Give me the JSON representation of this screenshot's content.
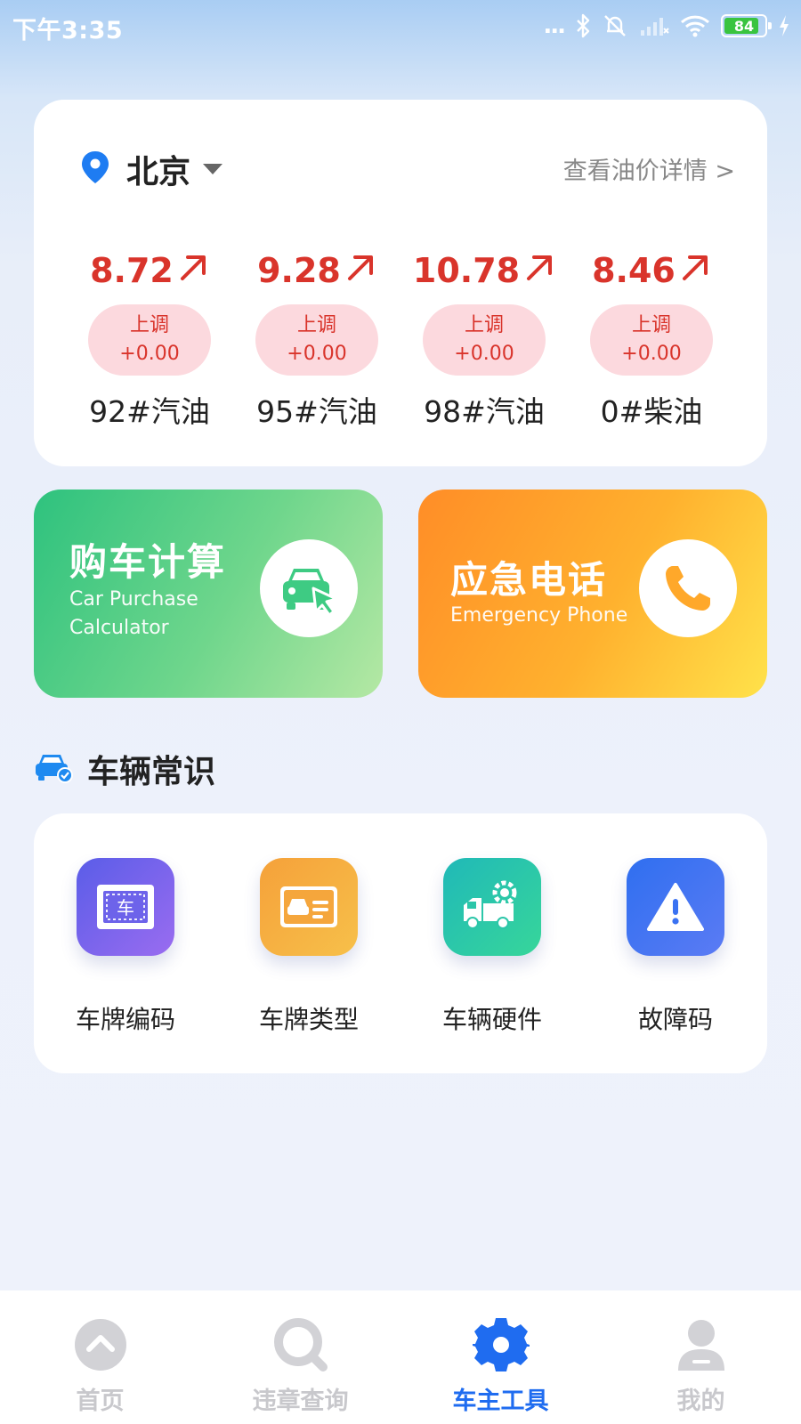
{
  "status_bar": {
    "time": "下午3:35",
    "dots": "...",
    "battery_level": "84"
  },
  "oil_card": {
    "city": "北京",
    "detail_link": "查看油价详情 >",
    "prices": [
      {
        "price": "8.72",
        "change_label": "上调",
        "change_value": "+0.00",
        "fuel": "92#汽油"
      },
      {
        "price": "9.28",
        "change_label": "上调",
        "change_value": "+0.00",
        "fuel": "95#汽油"
      },
      {
        "price": "10.78",
        "change_label": "上调",
        "change_value": "+0.00",
        "fuel": "98#汽油"
      },
      {
        "price": "8.46",
        "change_label": "上调",
        "change_value": "+0.00",
        "fuel": "0#柴油"
      }
    ]
  },
  "quick_cards": {
    "calculator": {
      "title": "购车计算",
      "subtitle_line1": "Car Purchase",
      "subtitle_line2": "Calculator",
      "icon": "car-cursor-icon"
    },
    "emergency": {
      "title": "应急电话",
      "subtitle": "Emergency Phone",
      "icon": "phone-icon"
    }
  },
  "section": {
    "title": "车辆常识",
    "icon": "car-check-icon"
  },
  "tools": [
    {
      "label": "车牌编码",
      "icon": "plate-code-icon",
      "plate_char": "车"
    },
    {
      "label": "车牌类型",
      "icon": "plate-type-icon"
    },
    {
      "label": "车辆硬件",
      "icon": "truck-gear-icon"
    },
    {
      "label": "故障码",
      "icon": "warning-icon"
    }
  ],
  "tabbar": {
    "tabs": [
      {
        "label": "首页",
        "icon": "home-icon"
      },
      {
        "label": "违章查询",
        "icon": "search-icon"
      },
      {
        "label": "车主工具",
        "icon": "gear-icon"
      },
      {
        "label": "我的",
        "icon": "person-icon"
      }
    ],
    "active_index": 2
  },
  "colors": {
    "price_red": "#d9342b",
    "pill_bg": "#fcd9de",
    "active_tab": "#1f6cf0",
    "inactive_tab": "#c8c8cc",
    "calculator_green": "#2ec27e",
    "emergency_orange": "#ff8d27"
  }
}
